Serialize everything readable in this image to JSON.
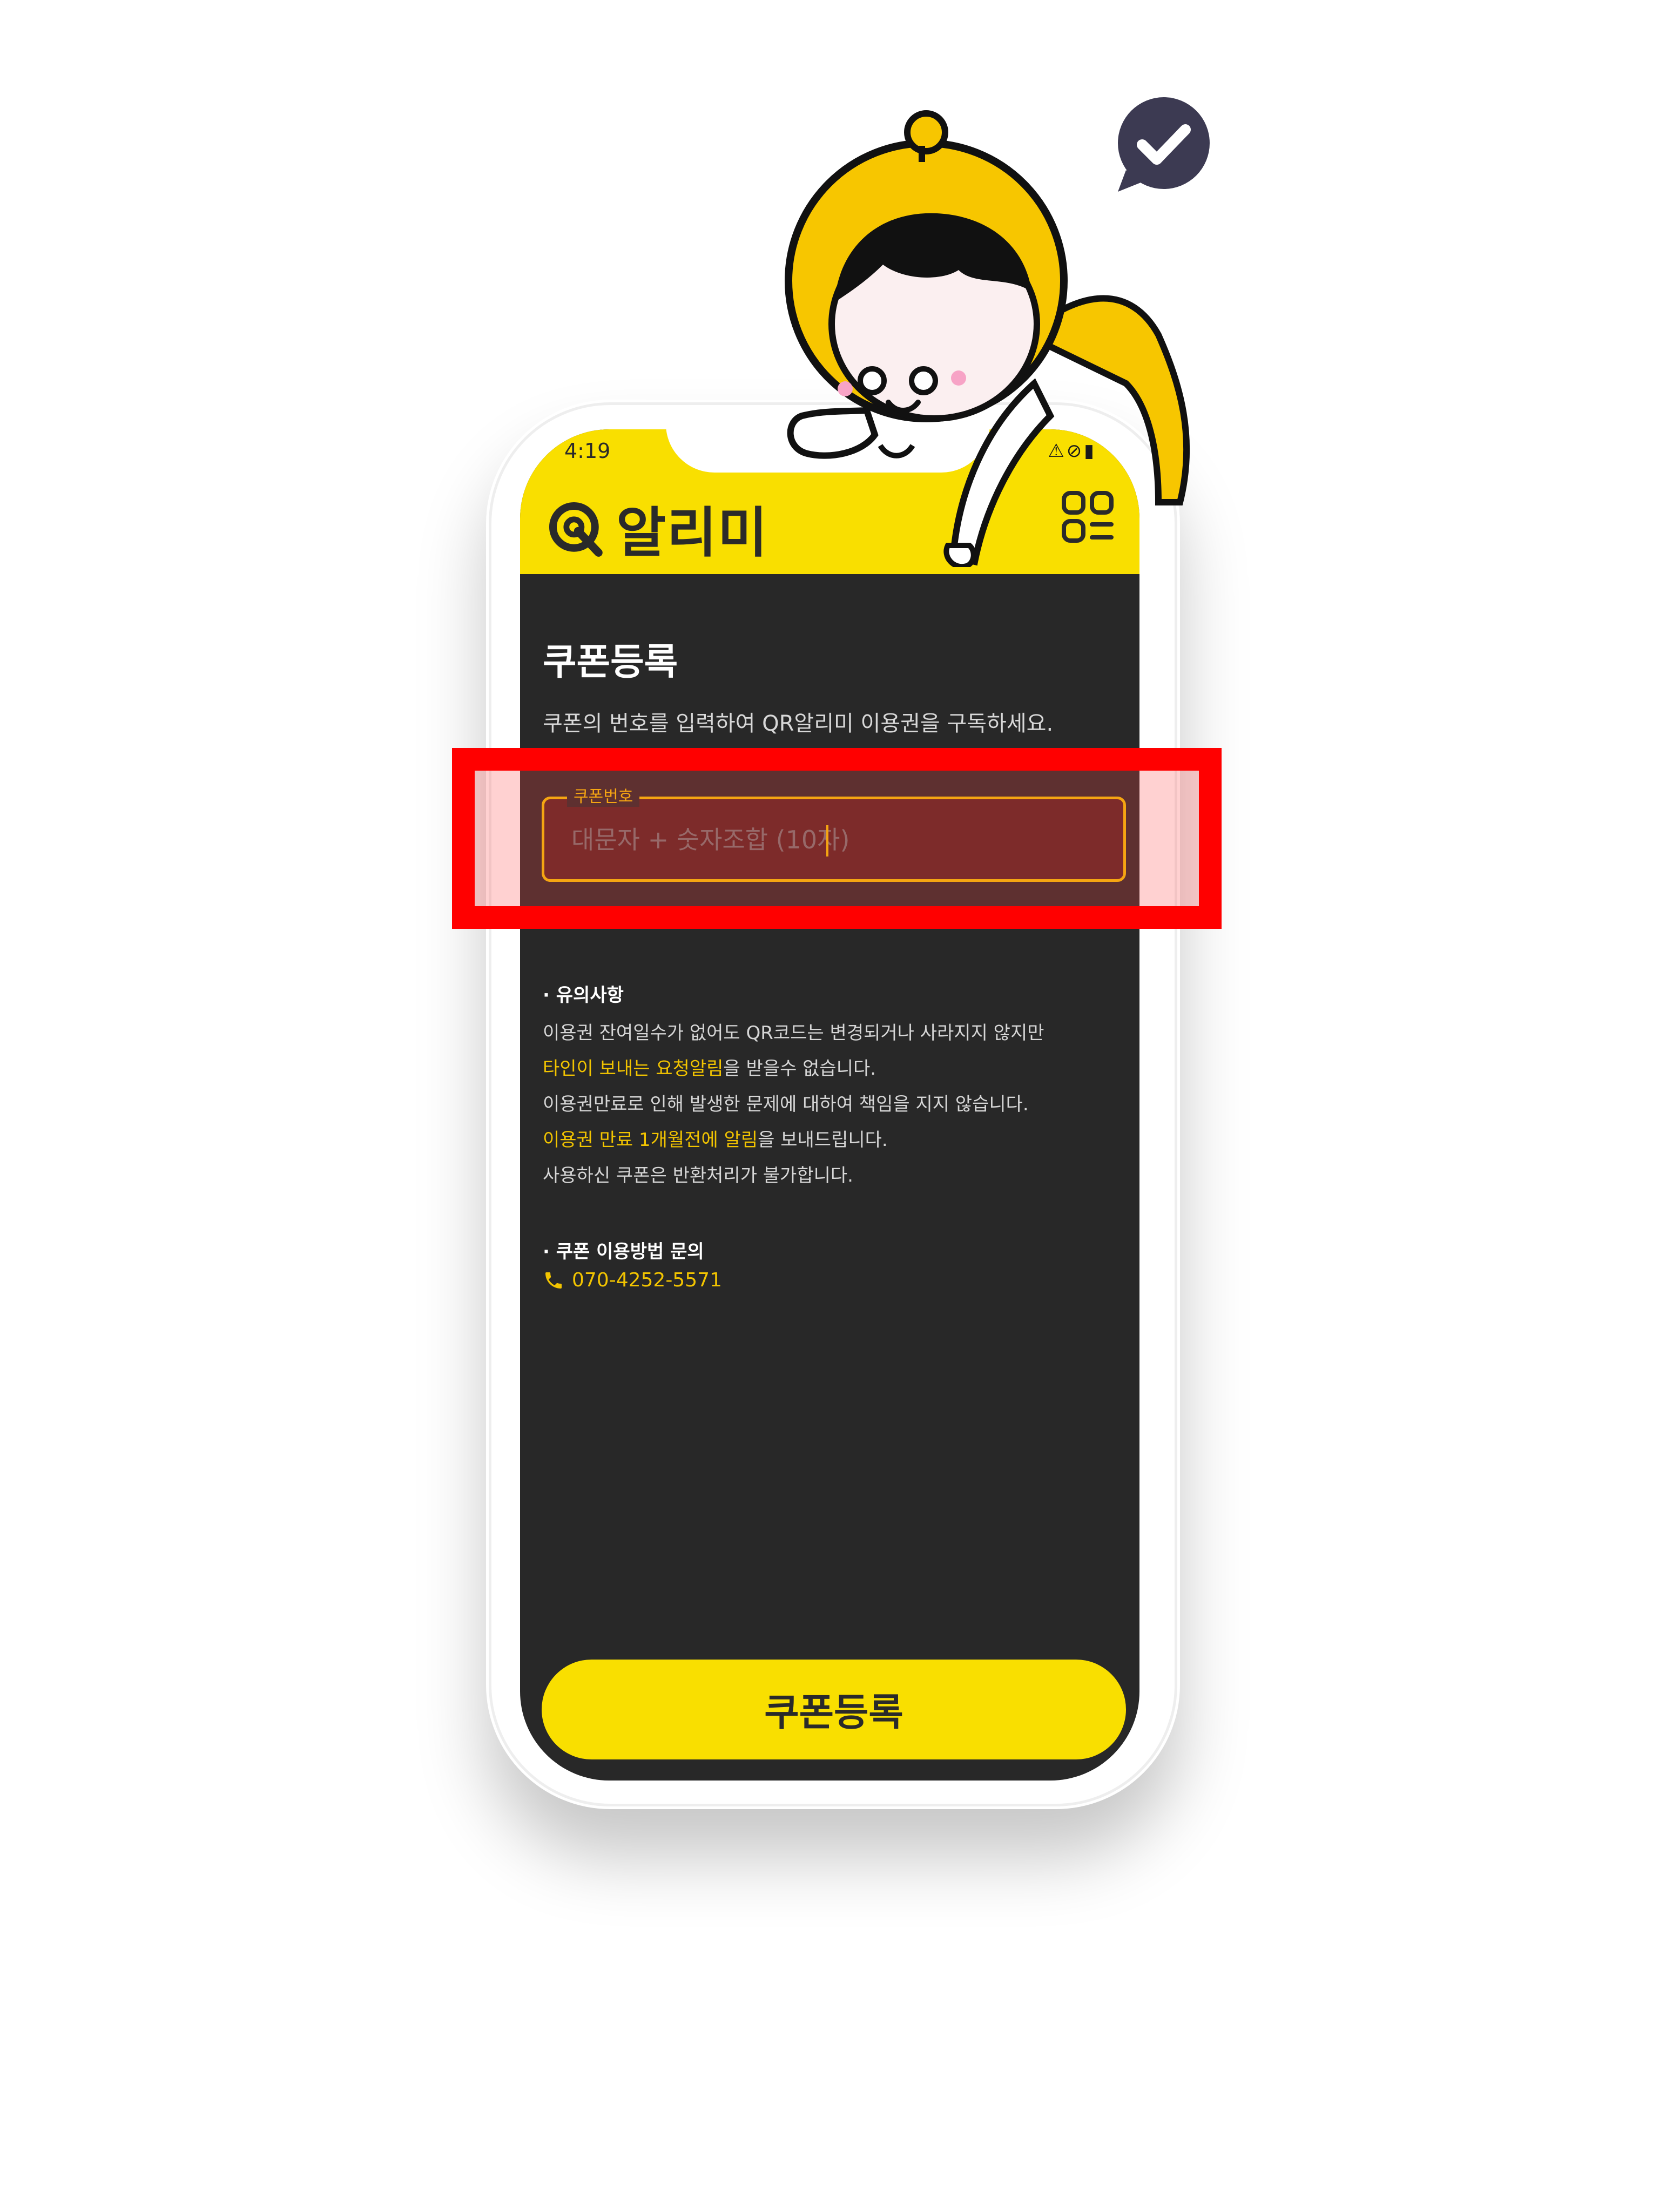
{
  "status_bar": {
    "time": "4:19",
    "icons": "⚠⊘▮"
  },
  "header": {
    "app_name": "알리미",
    "logo_icon": "qr-logo-icon",
    "menu_icon": "menu-grid-icon"
  },
  "main": {
    "title": "쿠폰등록",
    "description": "쿠폰의 번호를 입력하여 QR알리미 이용권을 구독하세요.",
    "coupon_field": {
      "label": "쿠폰번호",
      "placeholder": "대문자 + 숫자조합 (10자)",
      "value": ""
    }
  },
  "notice": {
    "heading": "· 유의사항",
    "lines": [
      [
        {
          "text": "이용권 잔여일수가 없어도 QR코드는 변경되거나 사라지지 않지만",
          "highlight": false
        }
      ],
      [
        {
          "text": "타인이 보내는 요청알림",
          "highlight": true
        },
        {
          "text": "을 받을수 없습니다.",
          "highlight": false
        }
      ],
      [
        {
          "text": "이용권만료로 인해 발생한 문제에 대하여 책임을 지지 않습니다.",
          "highlight": false
        }
      ],
      [
        {
          "text": "이용권 만료 1개월전에 알림",
          "highlight": true
        },
        {
          "text": "을 보내드립니다.",
          "highlight": false
        }
      ],
      [
        {
          "text": "사용하신 쿠폰은 반환처리가 불가합니다.",
          "highlight": false
        }
      ]
    ]
  },
  "inquiry": {
    "heading": "· 쿠폰 이용방법 문의",
    "phone_icon": "phone-icon",
    "phone": "070-4252-5571"
  },
  "submit_label": "쿠폰등록",
  "decorations": {
    "check_bubble_icon": "checkmark-chat-bubble-icon",
    "mascot": "yellow-hooded-mascot-illustration"
  },
  "colors": {
    "brand_yellow": "#f9df00",
    "accent_yellow": "#f2c400",
    "background_dark": "#282828",
    "highlight_red": "#ff0000"
  }
}
